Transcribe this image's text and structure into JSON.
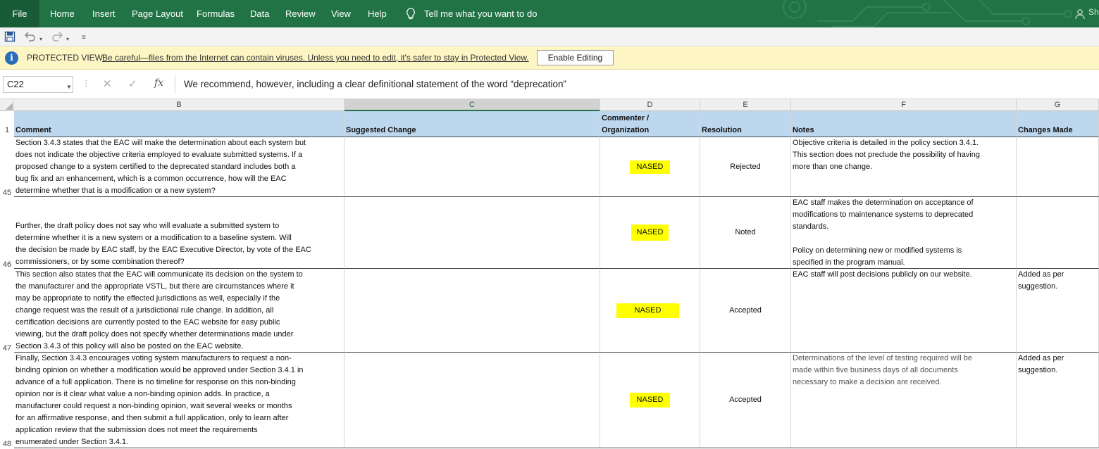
{
  "ribbon": {
    "tabs": [
      "File",
      "Home",
      "Insert",
      "Page Layout",
      "Formulas",
      "Data",
      "Review",
      "View",
      "Help"
    ],
    "tell_me": "Tell me what you want to do",
    "share": "Sha"
  },
  "protected_view": {
    "title": "PROTECTED VIEW",
    "message": "Be careful—files from the Internet can contain viruses. Unless you need to edit, it's safer to stay in Protected View.",
    "button": "Enable Editing"
  },
  "formula_bar": {
    "name_box": "C22",
    "fx": "fx",
    "formula": "We recommend, however, including a clear definitional statement of the word “deprecation”"
  },
  "columns": [
    "B",
    "C",
    "D",
    "E",
    "F",
    "G"
  ],
  "header_row": {
    "row": "1",
    "B": "Comment",
    "C": "Suggested  Change",
    "D": "Commenter / Organization",
    "E": "Resolution",
    "F": "Notes",
    "G": "Changes Made"
  },
  "rows": [
    {
      "row": "45",
      "B": "Section 3.4.3 states that the EAC will make the determination about each system but\ndoes not indicate the objective criteria employed to evaluate submitted systems. If a\nproposed change to a system certified to the deprecated standard includes both a\nbug fix and an enhancement, which is a common occurrence, how will the EAC\ndetermine whether that is a modification or a new system?",
      "D": "NASED",
      "E": "Rejected",
      "F": "Objective criteria is detailed in the policy section 3.4.1.\nThis section does not preclude the possibility of having\nmore than one change.",
      "G": ""
    },
    {
      "row": "46",
      "B": "Further, the draft policy does not say who will evaluate a submitted system to\ndetermine whether it is a new system or a modification to a baseline system. Will\nthe decision be made by EAC staff, by the EAC Executive Director, by vote of the EAC\ncommissioners, or by some combination thereof?",
      "D": "NASED",
      "E": "Noted",
      "F": "EAC staff makes the determination on acceptance of\nmodifications to maintenance systems to deprecated\nstandards.\n\nPolicy on determining new or modified systems is\nspecified in the program manual.",
      "G": ""
    },
    {
      "row": "47",
      "B": "This section also states that the EAC will communicate its decision on the system to\nthe manufacturer and the appropriate VSTL, but there are circumstances where it\nmay be appropriate to notify the effected jurisdictions as well, especially if the\nchange request was the result of a jurisdictional rule change. In addition, all\ncertification decisions are currently posted to the EAC website for easy public\nviewing, but the draft policy does not specify whether determinations made under\nSection 3.4.3 of this policy will also be posted on the EAC website.",
      "D": "NASED",
      "E": "Accepted",
      "F": "EAC staff will post decisions publicly on our website.",
      "G": "Added as per\nsuggestion."
    },
    {
      "row": "48",
      "B": "Finally, Section 3.4.3 encourages voting system manufacturers to request a non-\nbinding opinion on whether a modification would be approved under Section 3.4.1 in\nadvance of a full application. There is no timeline for response on this non-binding\nopinion nor is it clear what value a non-binding opinion adds. In practice, a\nmanufacturer could request a non-binding opinion, wait several weeks or months\nfor an affirmative response, and then submit a full application, only to learn after\napplication review that the submission does not meet the requirements\nenumerated under Section 3.4.1.",
      "D": "NASED",
      "E": "Accepted",
      "F": "Determinations of the level of testing required will be\nmade within five business days of all documents\nnecessary to make a decision are received.",
      "G": "Added as per\nsuggestion."
    }
  ]
}
